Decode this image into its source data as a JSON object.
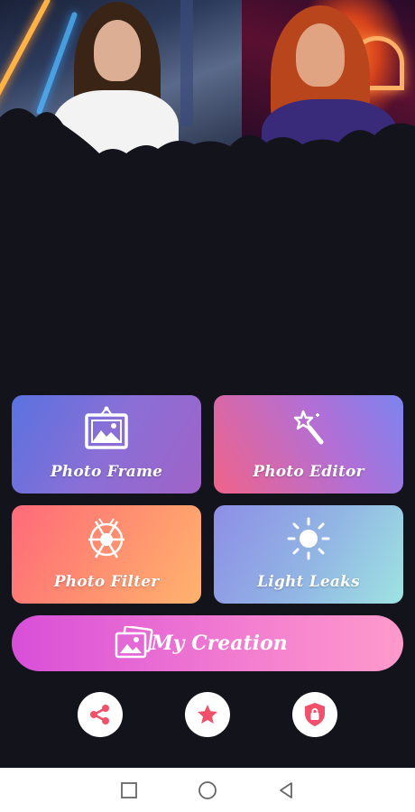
{
  "header": {
    "left_photo": "woman-white-shirt-neon-photo",
    "right_photo": "woman-neon-sign-photo"
  },
  "features": [
    {
      "id": "photo-frame",
      "label": "Photo Frame",
      "icon": "picture-frame-icon"
    },
    {
      "id": "photo-editor",
      "label": "Photo Editor",
      "icon": "magic-wand-icon"
    },
    {
      "id": "photo-filter",
      "label": "Photo Filter",
      "icon": "aperture-icon"
    },
    {
      "id": "light-leaks",
      "label": "Light Leaks",
      "icon": "sun-icon"
    }
  ],
  "my_creation": {
    "label": "My Creation",
    "icon": "photo-stack-icon"
  },
  "bottom_actions": [
    {
      "id": "share",
      "icon": "share-icon"
    },
    {
      "id": "rate",
      "icon": "star-icon"
    },
    {
      "id": "privacy",
      "icon": "shield-lock-icon"
    }
  ],
  "colors": {
    "background": "#13131c",
    "accent_icon": "#f0506a"
  }
}
